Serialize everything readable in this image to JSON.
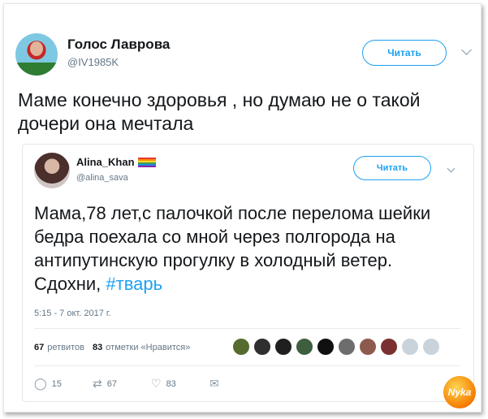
{
  "outer_tweet": {
    "author_name": "Голос Лаврова",
    "author_handle": "@IV1985K",
    "follow_label": "Читать",
    "text": "Маме конечно здоровья , но думаю не о такой дочери она мечтала"
  },
  "quoted_tweet": {
    "author_name": "Alina_Khan",
    "author_handle": "@alina_sava",
    "follow_label": "Читать",
    "text_main": "Мама,78 лет,с палочкой после перелома шейки бедра поехала со мной через полгорода на антипутинскую прогулку в холодный ветер. Сдохни, ",
    "hashtag": "#тварь",
    "timestamp": "5:15 - 7 окт. 2017 г.",
    "retweets_count": "67",
    "retweets_label": "ретвитов",
    "likes_count": "83",
    "likes_label": "отметки «Нравится»",
    "actions": {
      "reply": "15",
      "retweet": "67",
      "like": "83"
    }
  },
  "watermark": "Nyka",
  "colors": {
    "accent": "#1da1f2",
    "text": "#14171a",
    "muted": "#657786"
  },
  "liker_avatars": [
    "#556b2f",
    "#2f2f2f",
    "#1f1f1f",
    "#3e5f3e",
    "#101010",
    "#6d6d6d",
    "#8d5a50",
    "#7a3030",
    "#c9d3dc",
    "#c9d3dc"
  ]
}
